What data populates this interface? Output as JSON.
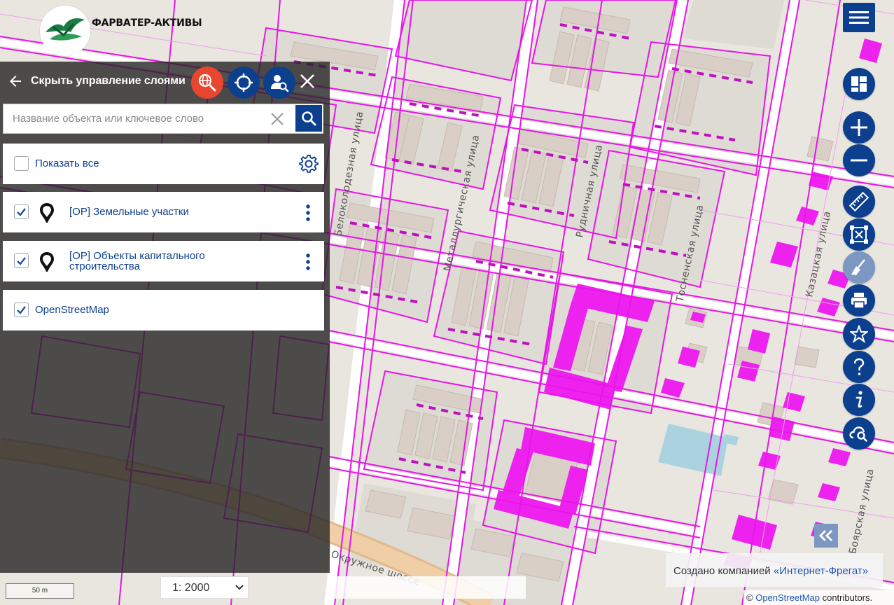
{
  "logo": {
    "text": "ФАРВАТЕР-АКТИВЫ"
  },
  "panel": {
    "title": "Скрыть управление слоями",
    "search": {
      "placeholder": "Название объекта или ключевое слово",
      "value": ""
    },
    "show_all": {
      "label": "Показать все",
      "checked": false
    },
    "layers": [
      {
        "label": "[ОР] Земельные участки",
        "checked": true
      },
      {
        "label": "[ОР] Объекты капитального строительства",
        "checked": true
      },
      {
        "label": "OpenStreetMap",
        "checked": true
      }
    ]
  },
  "toolbar": {
    "icons": [
      "menu-icon",
      "layers-grid-icon",
      "zoom-in-icon",
      "zoom-out-icon",
      "ruler-icon",
      "selection-icon",
      "eraser-icon",
      "print-icon",
      "star-icon",
      "help-icon",
      "info-icon",
      "cloud-search-icon",
      "collapse-icon"
    ],
    "accent": "#0d3f8f",
    "faded": "#7d97c3"
  },
  "map": {
    "streets": [
      "Белоколодезная улица",
      "Металлургическая улица",
      "Рудничная улица",
      "Тосненская улица",
      "Казацкая улица",
      "Боярская улица",
      "Окружное шоссе"
    ],
    "colors": {
      "parcel": "#e815e8",
      "building": "#d9cfc6",
      "road": "#ffffff",
      "water": "#aad3df",
      "ground": "#e9e5df"
    }
  },
  "credit": {
    "prefix": "Создано компанией ",
    "company": "«Интернет-Фрегат»"
  },
  "osm_credit": {
    "prefix": "© ",
    "link": "OpenStreetMap",
    "suffix": " contributors."
  },
  "scalebar": {
    "label": "50 m"
  },
  "scale_select": {
    "value": "1: 2000"
  }
}
